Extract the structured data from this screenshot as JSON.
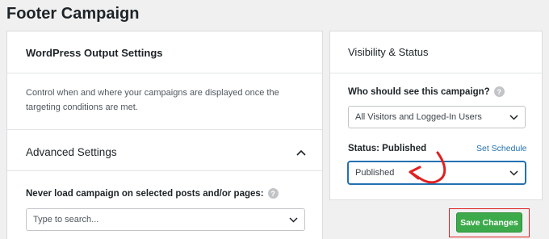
{
  "page": {
    "title": "Footer Campaign"
  },
  "wordpress_output": {
    "title": "WordPress Output Settings",
    "description": "Control when and where your campaigns are displayed once the targeting conditions are met."
  },
  "advanced": {
    "title": "Advanced Settings",
    "never_load_label": "Never load campaign on selected posts and/or pages:",
    "search_placeholder": "Type to search..."
  },
  "visibility": {
    "title": "Visibility & Status",
    "who_label": "Who should see this campaign?",
    "who_value": "All Visitors and Logged-In Users",
    "status_label": "Status: Published",
    "set_schedule": "Set Schedule",
    "status_value": "Published"
  },
  "actions": {
    "save_label": "Save Changes"
  },
  "colors": {
    "accent": "#2271b1",
    "save_green": "#3caa4a",
    "highlight_red": "#e02020"
  },
  "icons": {
    "help": "question-mark-circle-icon",
    "collapse": "chevron-up-icon",
    "dropdown": "chevron-down-icon"
  }
}
